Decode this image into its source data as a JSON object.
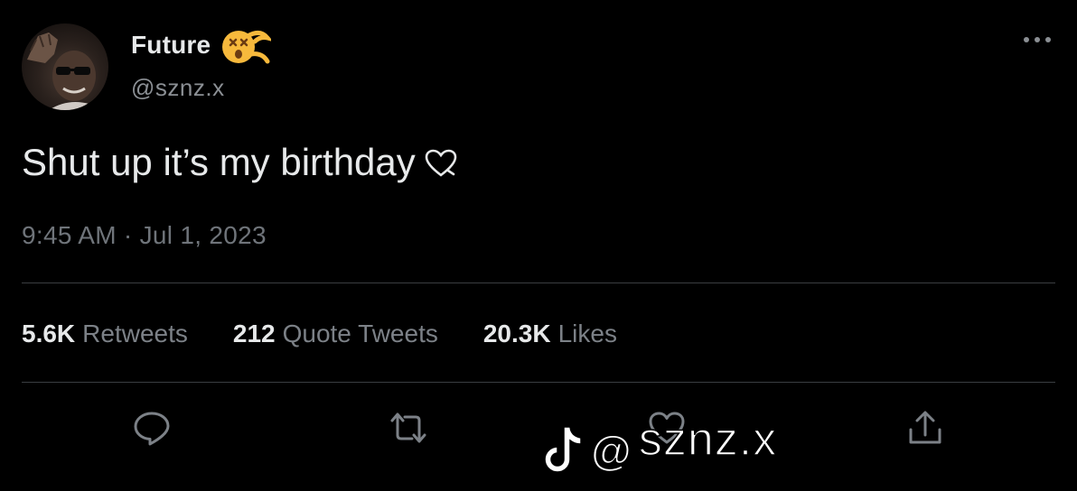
{
  "tweet": {
    "author": {
      "display_name": "Future",
      "name_emoji_icon": "dizzy-face-emoji-icon",
      "handle": "@sznz.x"
    },
    "text": "Shut up it’s my birthday",
    "text_trailing_icon": "heart-outline-icon",
    "timestamp": "9:45 AM · Jul 1, 2023",
    "stats": [
      {
        "value": "5.6K",
        "label": "Retweets"
      },
      {
        "value": "212",
        "label": "Quote Tweets"
      },
      {
        "value": "20.3K",
        "label": "Likes"
      }
    ],
    "actions": [
      "reply-icon",
      "retweet-icon",
      "like-icon",
      "share-icon"
    ]
  },
  "watermark": {
    "platform_icon": "tiktok-logo-icon",
    "at": "@",
    "handle": "sznz.x"
  },
  "colors": {
    "background": "#000000",
    "primary_text": "#e7e9ea",
    "secondary_text": "#8b8f94",
    "divider": "#3a3d41",
    "emoji_yellow": "#f7b93c"
  }
}
